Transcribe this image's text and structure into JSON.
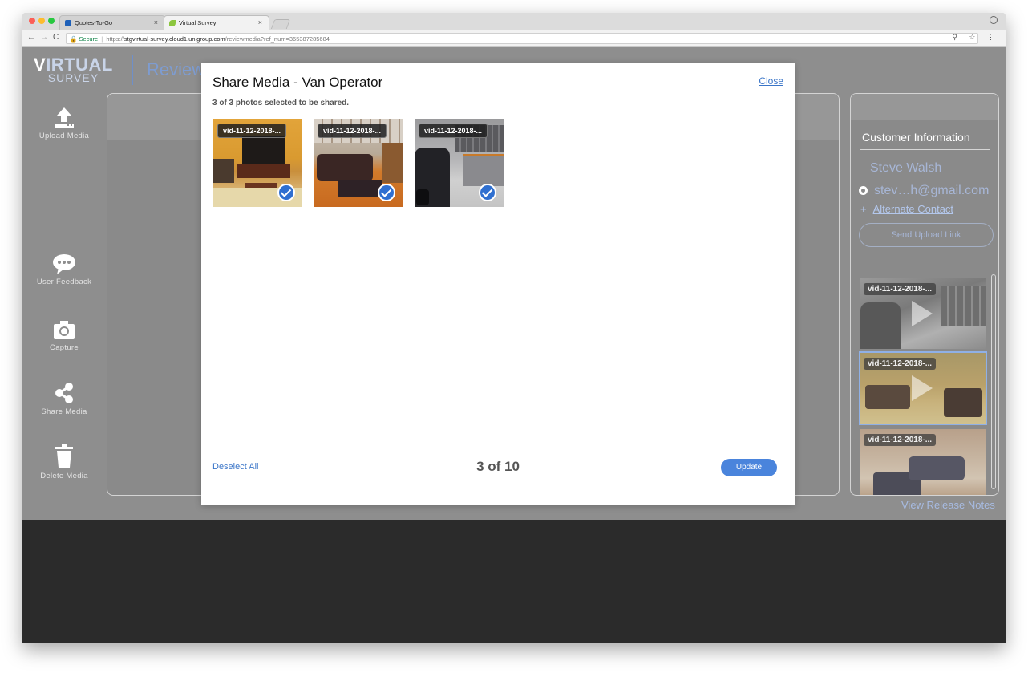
{
  "browser": {
    "tabs": [
      {
        "title": "Quotes-To-Go",
        "close": "×"
      },
      {
        "title": "Virtual Survey",
        "close": "×"
      }
    ],
    "url": {
      "secure_label": "Secure",
      "scheme": "https://",
      "domain": "stgvirtual-survey.cloud1.unigroup.com",
      "path": "/reviewmedia?ref_num=365387285684"
    },
    "nav": {
      "back": "←",
      "forward": "→",
      "reload": "C"
    },
    "toolbar_icons": "⚲ ☆ ⋮"
  },
  "app": {
    "logo": {
      "line1_first": "V",
      "line1_rest": "IRTUAL",
      "line2": "SURVEY"
    },
    "page_title": "Review",
    "sidebar": [
      {
        "label": "Upload Media",
        "icon": "upload-icon"
      },
      {
        "label": "User Feedback",
        "icon": "chat-bubble-icon"
      },
      {
        "label": "Capture",
        "icon": "camera-icon"
      },
      {
        "label": "Share Media",
        "icon": "share-icon"
      },
      {
        "label": "Delete Media",
        "icon": "trash-icon"
      }
    ],
    "customer": {
      "title": "Customer Information",
      "name": "Steve Walsh",
      "email": "stev…h@gmail.com",
      "alternate_contact": "Alternate Contact",
      "plus": "+",
      "send_upload_link": "Send Upload Link"
    },
    "video_thumbs": [
      {
        "label": "vid-11-12-2018-..."
      },
      {
        "label": "vid-11-12-2018-..."
      },
      {
        "label": "vid-11-12-2018-..."
      }
    ],
    "release_notes": "View Release Notes"
  },
  "modal": {
    "title": "Share Media - Van Operator",
    "close": "Close",
    "subtitle": "3 of 3 photos selected to be shared.",
    "photos": [
      {
        "label": "vid-11-12-2018-...",
        "selected": true
      },
      {
        "label": "vid-11-12-2018-...",
        "selected": true
      },
      {
        "label": "vid-11-12-2018-...",
        "selected": true
      }
    ],
    "deselect_all": "Deselect All",
    "pager": "3 of 10",
    "update": "Update"
  },
  "colors": {
    "accent": "#4a84dc",
    "link": "#3a75c8",
    "check": "#2f6fd0",
    "overlay": "#8e8e8e"
  }
}
